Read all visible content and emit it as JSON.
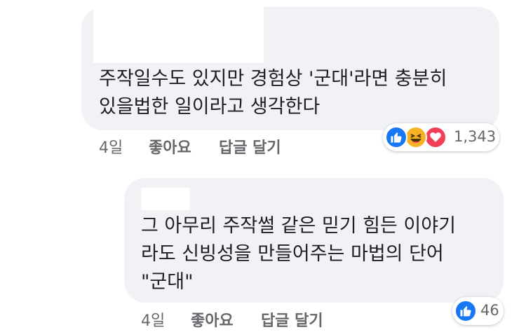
{
  "comments": [
    {
      "text_lines": [
        "주작일수도 있지만 경험상 '군대'라면 충분히",
        "있을법한 일이라고 생각한다"
      ],
      "time": "4일",
      "like_label": "좋아요",
      "reply_label": "답글 달기",
      "reactions": [
        "like",
        "haha",
        "love"
      ],
      "reaction_count": "1,343"
    },
    {
      "text_lines": [
        "그 아무리 주작썰 같은 믿기 힘든 이야기",
        "라도 신빙성을 만들어주는 마법의 단어",
        "\"군대\""
      ],
      "time": "4일",
      "like_label": "좋아요",
      "reply_label": "답글 달기",
      "reactions": [
        "like"
      ],
      "reaction_count": "46"
    }
  ],
  "colors": {
    "bubble": "#f0f2f5",
    "like": "#1877f2",
    "haha": "#f7b125",
    "love": "#f33e58",
    "meta_text": "#65676b"
  }
}
